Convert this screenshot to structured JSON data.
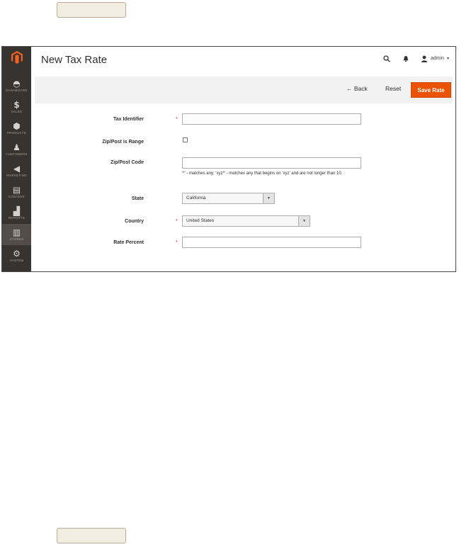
{
  "colors": {
    "sidebar": "#373330",
    "accent": "#eb5202",
    "required": "#e22626"
  },
  "header": {
    "title": "New Tax Rate",
    "search_icon": "search-icon",
    "bell_icon": "bell-icon",
    "user_icon": "user-icon",
    "user_name": "admin"
  },
  "sidebar": {
    "items": [
      {
        "label": "DASHBOARD",
        "icon": "dashboard-icon"
      },
      {
        "label": "SALES",
        "icon": "dollar-icon"
      },
      {
        "label": "PRODUCTS",
        "icon": "cube-icon"
      },
      {
        "label": "CUSTOMERS",
        "icon": "person-icon"
      },
      {
        "label": "MARKETING",
        "icon": "megaphone-icon"
      },
      {
        "label": "CONTENT",
        "icon": "layout-icon"
      },
      {
        "label": "REPORTS",
        "icon": "bar-chart-icon"
      },
      {
        "label": "STORES",
        "icon": "store-icon"
      },
      {
        "label": "SYSTEM",
        "icon": "gear-icon"
      }
    ],
    "active": "STORES"
  },
  "actions": {
    "back": "Back",
    "reset": "Reset",
    "save": "Save Rate"
  },
  "form": {
    "tax_identifier": {
      "label": "Tax Identifier",
      "value": ""
    },
    "zip_is_range": {
      "label": "Zip/Post is Range",
      "checked": false
    },
    "zip_code": {
      "label": "Zip/Post Code",
      "value": "",
      "note": "'*' - matches any; 'xyz*' - matches any that begins on 'xyz' and are not longer than 10."
    },
    "state": {
      "label": "State",
      "value": "California"
    },
    "country": {
      "label": "Country",
      "value": "United States"
    },
    "rate_percent": {
      "label": "Rate Percent",
      "value": ""
    }
  }
}
